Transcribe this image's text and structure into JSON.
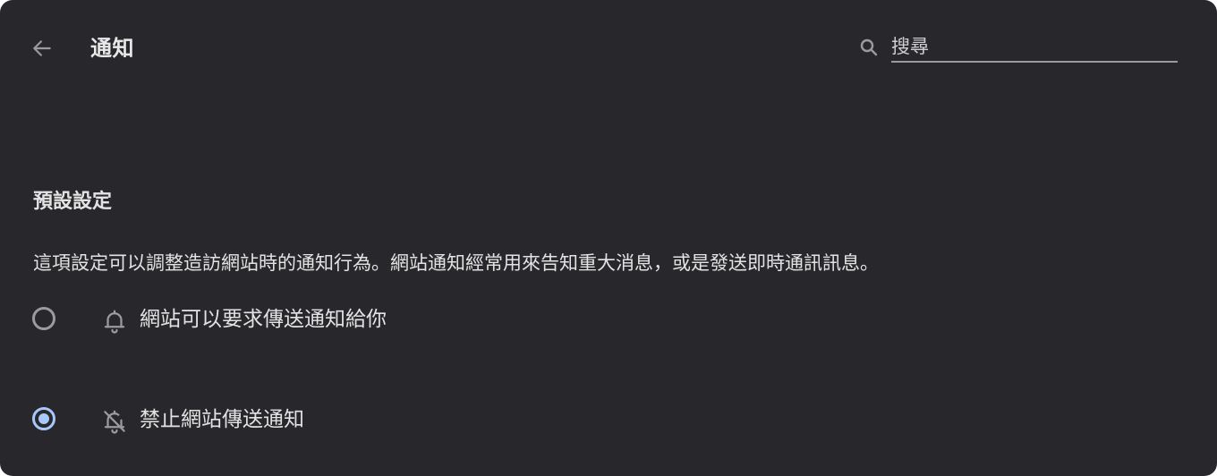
{
  "header": {
    "title": "通知",
    "back_icon": "arrow-left-icon"
  },
  "search": {
    "placeholder": "搜尋",
    "icon": "search-icon"
  },
  "defaults": {
    "title": "預設設定",
    "description": "這項設定可以調整造訪網站時的通知行為。網站通知經常用來告知重大消息，或是發送即時通訊訊息。",
    "options": [
      {
        "label": "網站可以要求傳送通知給你",
        "icon": "bell-icon",
        "selected": false
      },
      {
        "label": "禁止網站傳送通知",
        "icon": "bell-off-icon",
        "selected": true
      }
    ]
  },
  "colors": {
    "background": "#28282c",
    "text": "#e3e3e3",
    "accent": "#a8c7fa",
    "icon": "#9b9b9f"
  }
}
